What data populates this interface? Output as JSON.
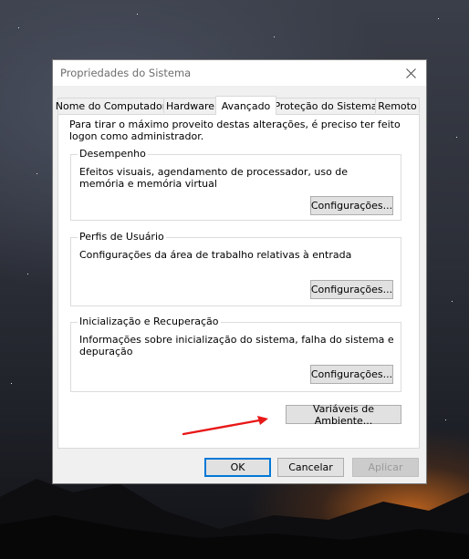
{
  "window": {
    "title": "Propriedades do Sistema",
    "close_icon": "close-icon"
  },
  "tabs": [
    {
      "label": "Nome do Computador",
      "active": false
    },
    {
      "label": "Hardware",
      "active": false
    },
    {
      "label": "Avançado",
      "active": true
    },
    {
      "label": "Proteção do Sistema",
      "active": false
    },
    {
      "label": "Remoto",
      "active": false
    }
  ],
  "panel": {
    "intro": "Para tirar o máximo proveito destas alterações, é preciso ter feito logon como administrador.",
    "groups": [
      {
        "label": "Desempenho",
        "text": "Efeitos visuais, agendamento de processador, uso de memória e memória virtual",
        "button": "Configurações..."
      },
      {
        "label": "Perfis de Usuário",
        "text": "Configurações da área de trabalho relativas à entrada",
        "button": "Configurações..."
      },
      {
        "label": "Inicialização e Recuperação",
        "text": "Informações sobre inicialização do sistema, falha do sistema e depuração",
        "button": "Configurações..."
      }
    ],
    "env_button": "Variáveis de Ambiente..."
  },
  "footer": {
    "ok": "OK",
    "cancel": "Cancelar",
    "apply": "Aplicar"
  },
  "colors": {
    "annotation_arrow": "#e81818",
    "focus_border": "#0078d7"
  }
}
